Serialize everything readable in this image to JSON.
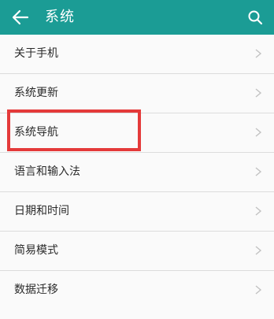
{
  "app_bar": {
    "title": "系统",
    "back_icon": "arrow-left-icon",
    "search_icon": "search-icon",
    "background": "#1b9c95"
  },
  "menu": {
    "items": [
      {
        "label": "关于手机"
      },
      {
        "label": "系统更新"
      },
      {
        "label": "系统导航",
        "highlighted": true
      },
      {
        "label": "语言和输入法"
      },
      {
        "label": "日期和时间"
      },
      {
        "label": "简易模式"
      },
      {
        "label": "数据迁移"
      }
    ],
    "chevron_icon": "chevron-right-icon"
  },
  "highlight": {
    "color": "#e43a3a",
    "target_index": 2
  }
}
